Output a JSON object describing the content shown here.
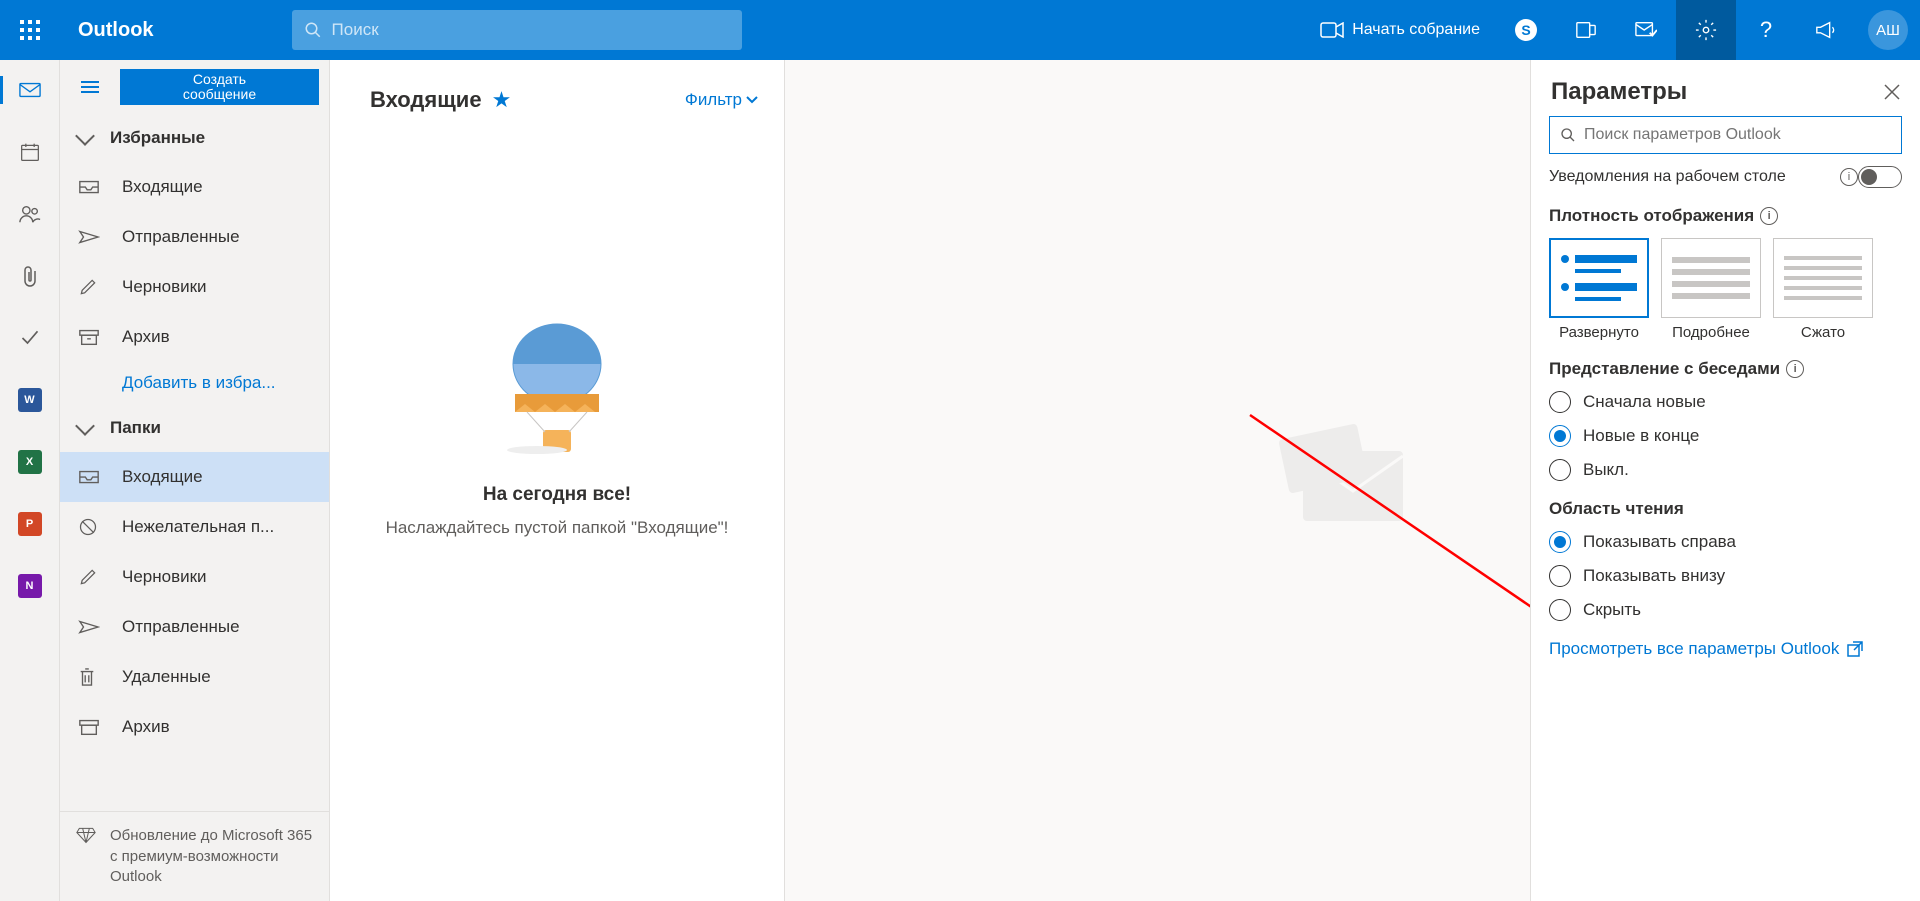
{
  "header": {
    "brand": "Outlook",
    "search_placeholder": "Поиск",
    "meet_label": "Начать собрание",
    "avatar_initials": "АШ"
  },
  "compose_button": "Создать\nсообщение",
  "favorites": {
    "title": "Избранные",
    "items": [
      "Входящие",
      "Отправленные",
      "Черновики",
      "Архив"
    ],
    "add_label": "Добавить в избра..."
  },
  "folders": {
    "title": "Папки",
    "items": [
      "Входящие",
      "Нежелательная п...",
      "Черновики",
      "Отправленные",
      "Удаленные",
      "Архив"
    ]
  },
  "upgrade_text": "Обновление до Microsoft 365 с премиум-возможности Outlook",
  "inbox": {
    "title": "Входящие",
    "filter": "Фильтр",
    "empty_title": "На сегодня все!",
    "empty_sub": "Наслаждайтесь пустой папкой \"Входящие\"!"
  },
  "settings": {
    "title": "Параметры",
    "search_placeholder": "Поиск параметров Outlook",
    "desktop_notif": "Уведомления на рабочем столе",
    "density_title": "Плотность отображения",
    "density_opts": [
      "Развернуто",
      "Подробнее",
      "Сжато"
    ],
    "conv_title": "Представление с беседами",
    "conv_opts": [
      "Сначала новые",
      "Новые в конце",
      "Выкл."
    ],
    "reading_title": "Область чтения",
    "reading_opts": [
      "Показывать справа",
      "Показывать внизу",
      "Скрыть"
    ],
    "all_link": "Просмотреть все параметры Outlook"
  }
}
